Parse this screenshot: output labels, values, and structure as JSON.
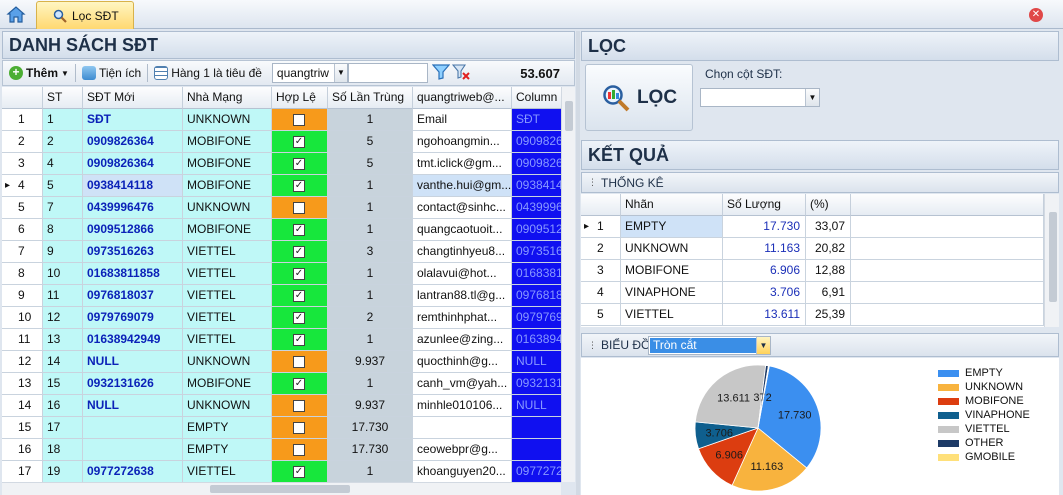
{
  "tab": {
    "label": "Lọc SĐT"
  },
  "left": {
    "title": "DANH SÁCH SĐT",
    "toolbar": {
      "add_label": "Thêm",
      "util_label": "Tiện ích",
      "header_row_label": "Hàng 1 là tiêu đề",
      "sheet_value": "quangtriw",
      "search_value": "",
      "count": "53.607"
    },
    "columns": [
      "",
      "ST",
      "SĐT Mới",
      "Nhà Mạng",
      "Hợp Lệ",
      "Số Lần Trùng",
      "quangtriweb@...",
      "Column"
    ],
    "rows": [
      {
        "idx": "1",
        "st": "1",
        "sdt": "SĐT",
        "nm": "UNKNOWN",
        "ok": false,
        "dup": "1",
        "email": "Email",
        "col": "SĐT",
        "ok_color": "#f79a1b"
      },
      {
        "idx": "2",
        "st": "2",
        "sdt": "0909826364",
        "nm": "MOBIFONE",
        "ok": true,
        "dup": "5",
        "email": "ngohoangmin...",
        "col": "0909826364",
        "ok_color": "#17e73c"
      },
      {
        "idx": "3",
        "st": "4",
        "sdt": "0909826364",
        "nm": "MOBIFONE",
        "ok": true,
        "dup": "5",
        "email": "tmt.iclick@gm...",
        "col": "0909826364",
        "ok_color": "#17e73c"
      },
      {
        "idx": "4",
        "st": "5",
        "sdt": "0938414118",
        "nm": "MOBIFONE",
        "ok": true,
        "dup": "1",
        "email": "vanthe.hui@gm...",
        "col": "0938414118",
        "ok_color": "#17e73c",
        "selected": true
      },
      {
        "idx": "5",
        "st": "7",
        "sdt": "0439996476",
        "nm": "UNKNOWN",
        "ok": false,
        "dup": "1",
        "email": "contact@sinhc...",
        "col": "0439996476",
        "ok_color": "#f79a1b"
      },
      {
        "idx": "6",
        "st": "8",
        "sdt": "0909512866",
        "nm": "MOBIFONE",
        "ok": true,
        "dup": "1",
        "email": "quangcaotuoit...",
        "col": "0909512866",
        "ok_color": "#17e73c"
      },
      {
        "idx": "7",
        "st": "9",
        "sdt": "0973516263",
        "nm": "VIETTEL",
        "ok": true,
        "dup": "3",
        "email": "changtinhyeu8...",
        "col": "0973516263",
        "ok_color": "#17e73c"
      },
      {
        "idx": "8",
        "st": "10",
        "sdt": "01683811858",
        "nm": "VIETTEL",
        "ok": true,
        "dup": "1",
        "email": "olalavui@hot...",
        "col": "01683811858",
        "ok_color": "#17e73c"
      },
      {
        "idx": "9",
        "st": "11",
        "sdt": "0976818037",
        "nm": "VIETTEL",
        "ok": true,
        "dup": "1",
        "email": "lantran88.tl@g...",
        "col": "0976818037",
        "ok_color": "#17e73c"
      },
      {
        "idx": "10",
        "st": "12",
        "sdt": "0979769079",
        "nm": "VIETTEL",
        "ok": true,
        "dup": "2",
        "email": "remthinhphat...",
        "col": "0979769079",
        "ok_color": "#17e73c"
      },
      {
        "idx": "11",
        "st": "13",
        "sdt": "01638942949",
        "nm": "VIETTEL",
        "ok": true,
        "dup": "1",
        "email": "azunlee@zing...",
        "col": "01638942949",
        "ok_color": "#17e73c"
      },
      {
        "idx": "12",
        "st": "14",
        "sdt": "NULL",
        "nm": "UNKNOWN",
        "ok": false,
        "dup": "9.937",
        "email": "quocthinh@g...",
        "col": "NULL",
        "ok_color": "#f79a1b"
      },
      {
        "idx": "13",
        "st": "15",
        "sdt": "0932131626",
        "nm": "MOBIFONE",
        "ok": true,
        "dup": "1",
        "email": "canh_vm@yah...",
        "col": "0932131626",
        "ok_color": "#17e73c"
      },
      {
        "idx": "14",
        "st": "16",
        "sdt": "NULL",
        "nm": "UNKNOWN",
        "ok": false,
        "dup": "9.937",
        "email": "minhle010106...",
        "col": "NULL",
        "ok_color": "#f79a1b"
      },
      {
        "idx": "15",
        "st": "17",
        "sdt": "",
        "nm": "EMPTY",
        "ok": false,
        "dup": "17.730",
        "email": "",
        "col": "",
        "ok_color": "#f79a1b"
      },
      {
        "idx": "16",
        "st": "18",
        "sdt": "",
        "nm": "EMPTY",
        "ok": false,
        "dup": "17.730",
        "email": "ceowebpr@g...",
        "col": "",
        "ok_color": "#f79a1b"
      },
      {
        "idx": "17",
        "st": "19",
        "sdt": "0977272638",
        "nm": "VIETTEL",
        "ok": true,
        "dup": "1",
        "email": "khoanguyen20...",
        "col": "0977272638",
        "ok_color": "#17e73c"
      }
    ]
  },
  "right": {
    "loc_title": "LỌC",
    "loc_button": "LỌC",
    "chon_label": "Chọn cột SĐT:",
    "chon_value": "",
    "ketqua_title": "KẾT QUẢ",
    "thongke_label": "THỐNG KÊ",
    "stats_columns": [
      "",
      "Nhãn",
      "Số Lượng",
      "(%)"
    ],
    "stats": [
      {
        "i": "1",
        "label": "EMPTY",
        "count": "17.730",
        "pct": "33,07"
      },
      {
        "i": "2",
        "label": "UNKNOWN",
        "count": "11.163",
        "pct": "20,82"
      },
      {
        "i": "3",
        "label": "MOBIFONE",
        "count": "6.906",
        "pct": "12,88"
      },
      {
        "i": "4",
        "label": "VINAPHONE",
        "count": "3.706",
        "pct": "6,91"
      },
      {
        "i": "5",
        "label": "VIETTEL",
        "count": "13.611",
        "pct": "25,39"
      }
    ],
    "bieudo_label": "BIỂU ĐỒ",
    "chart_type_value": "Tròn cắt"
  },
  "chart_data": {
    "type": "pie",
    "series": [
      {
        "label": "EMPTY",
        "value": 17730,
        "text": "17.730",
        "color": "#3b8ff0"
      },
      {
        "label": "UNKNOWN",
        "value": 11163,
        "text": "11.163",
        "color": "#f8b33e"
      },
      {
        "label": "MOBIFONE",
        "value": 6906,
        "text": "6.906",
        "color": "#dc3d10"
      },
      {
        "label": "VINAPHONE",
        "value": 3706,
        "text": "3.706",
        "color": "#0f5f8e"
      },
      {
        "label": "VIETTEL",
        "value": 13611,
        "text": "13.611",
        "color": "#c7c7c7"
      },
      {
        "label": "OTHER",
        "value": 372,
        "text": "372",
        "color": "#1d3a66"
      },
      {
        "label": "GMOBILE",
        "value": 119,
        "text": "",
        "color": "#ffe07a"
      }
    ],
    "legend": [
      "EMPTY",
      "UNKNOWN",
      "MOBIFONE",
      "VINAPHONE",
      "VIETTEL",
      "OTHER",
      "GMOBILE"
    ],
    "legend_placement": "right"
  }
}
